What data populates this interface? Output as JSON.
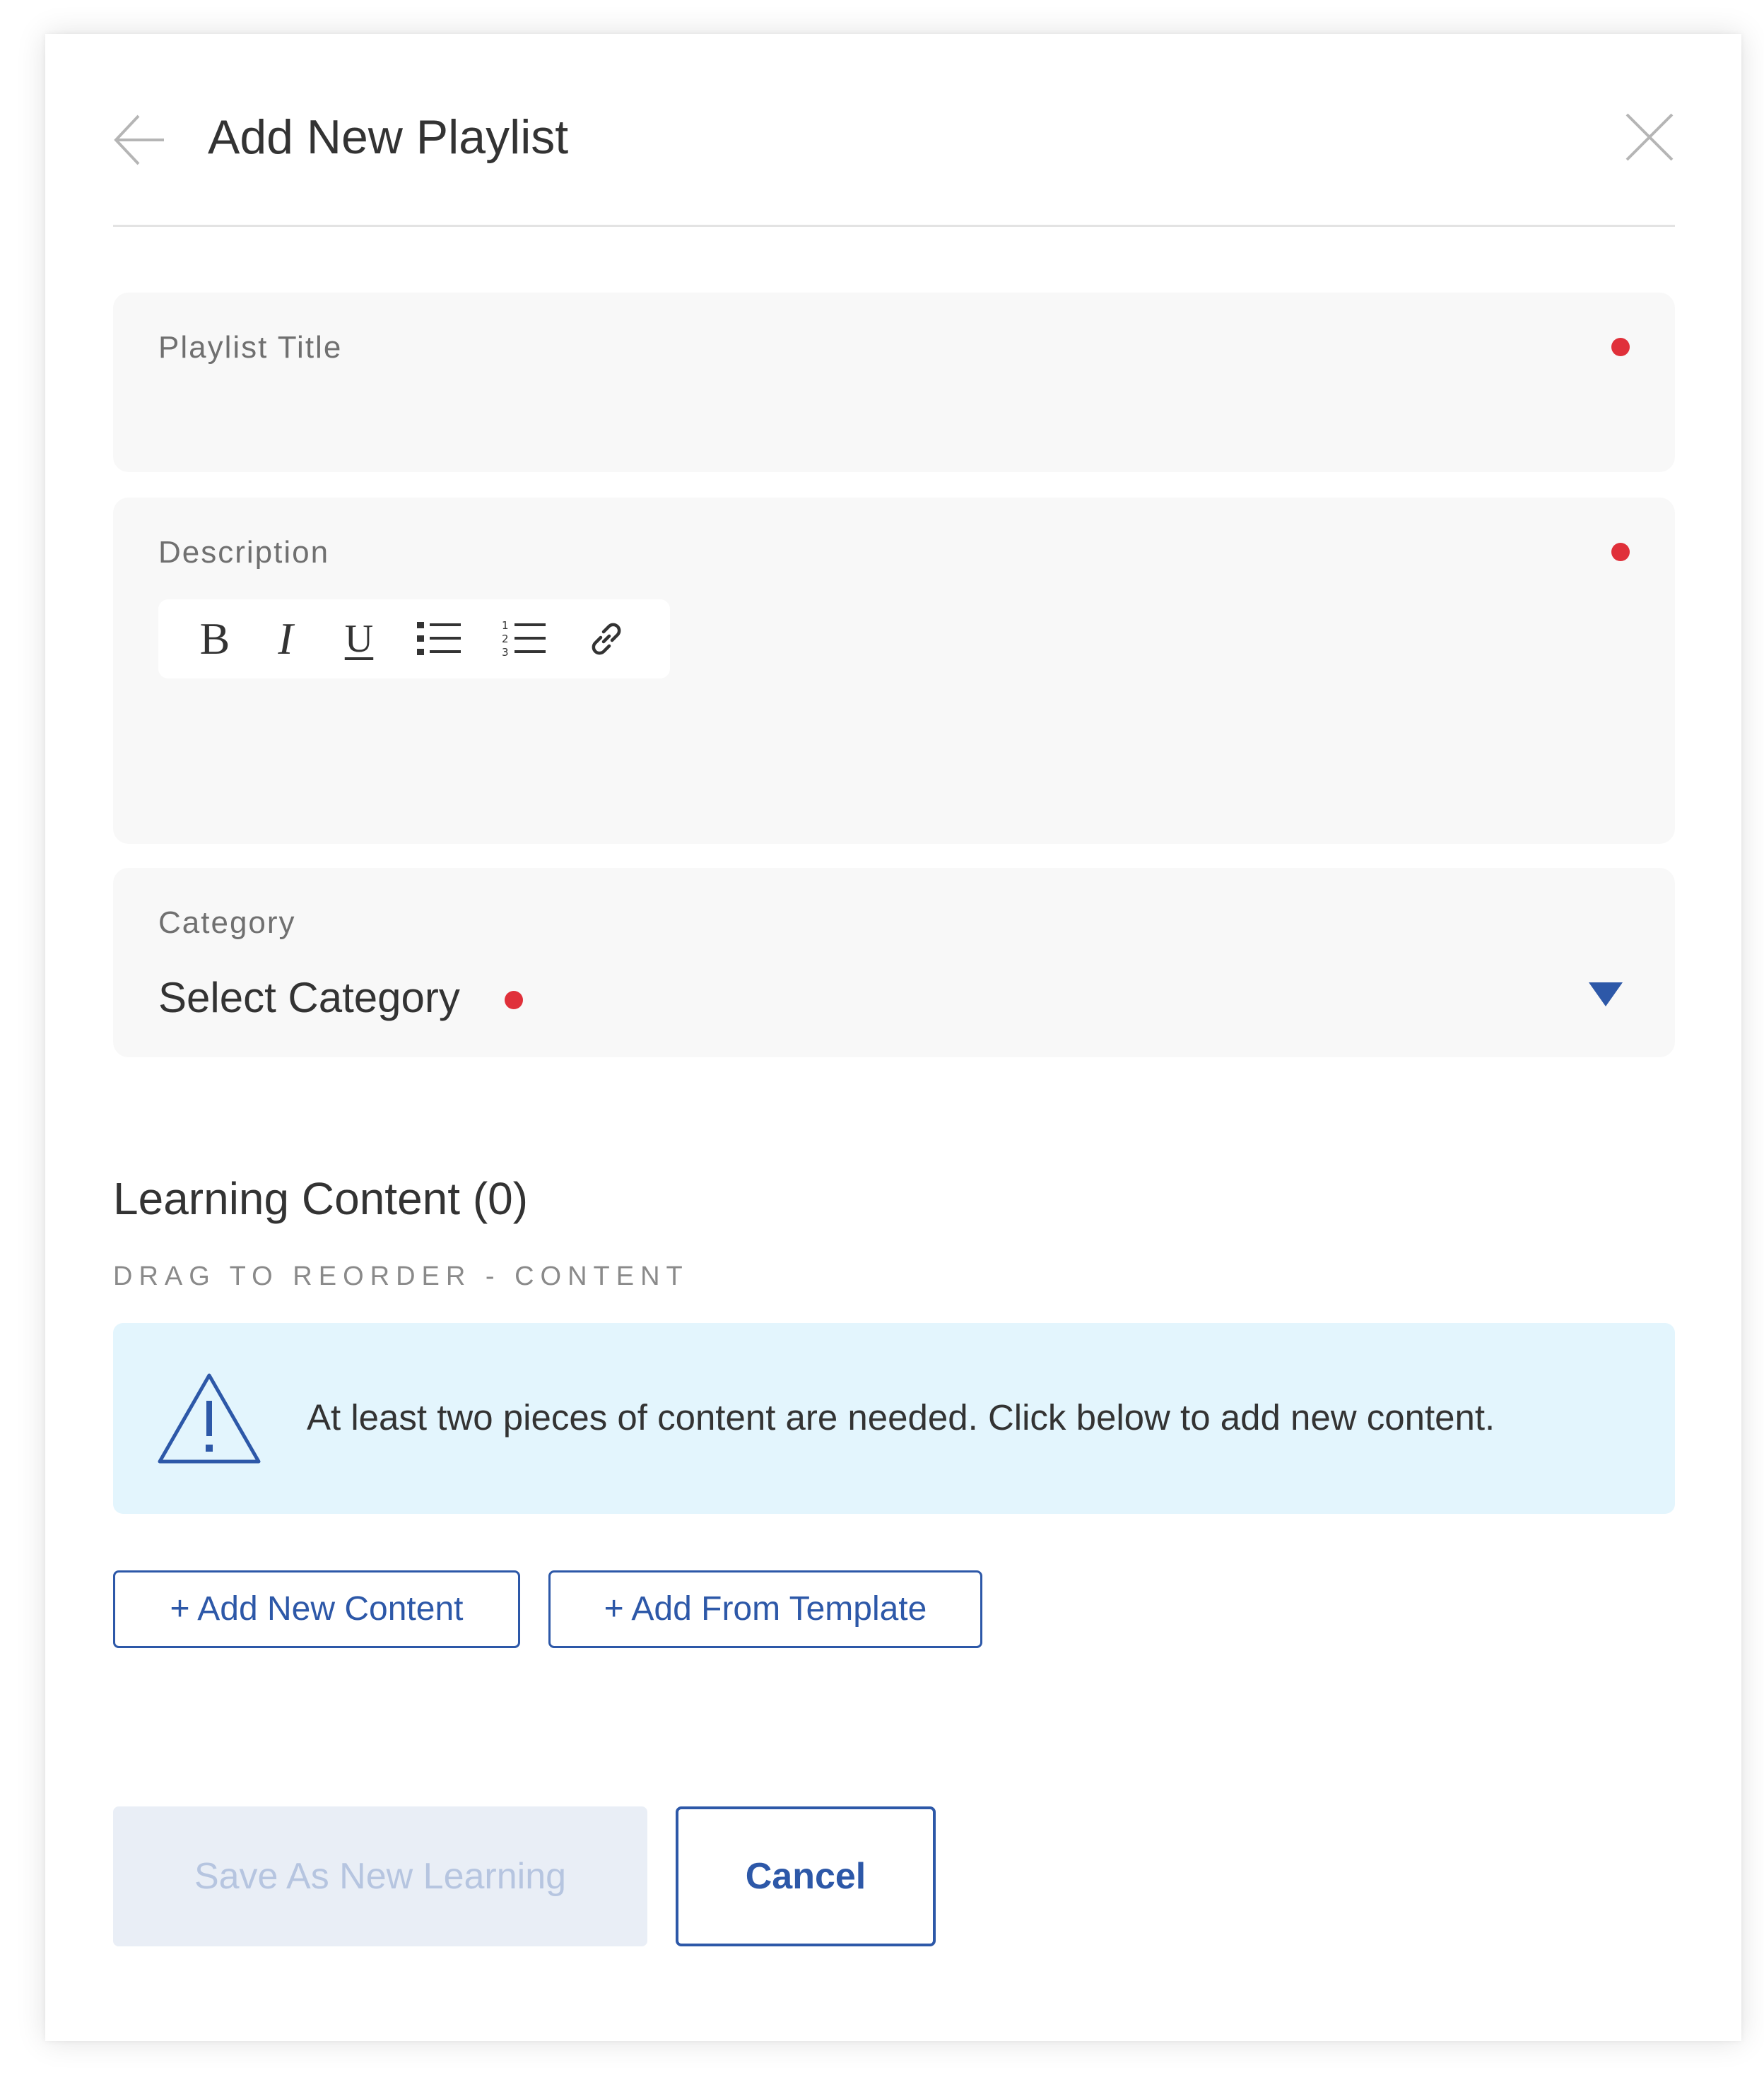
{
  "header": {
    "title": "Add New Playlist",
    "back_icon": "arrow-left-icon",
    "close_icon": "close-icon"
  },
  "form": {
    "title_field": {
      "label": "Playlist Title",
      "value": "",
      "required": true
    },
    "description_field": {
      "label": "Description",
      "required": true,
      "toolbar": {
        "bold_label": "B",
        "italic_label": "I",
        "underline_label": "U",
        "bullet_list_icon": "bulleted-list-icon",
        "numbered_list_icon": "numbered-list-icon",
        "link_icon": "link-icon"
      }
    },
    "category_field": {
      "label": "Category",
      "selected": "Select Category",
      "required": true,
      "caret_icon": "caret-down-icon"
    }
  },
  "learning_content": {
    "title": "Learning Content (0)",
    "subtitle": "DRAG TO REORDER - CONTENT",
    "alert": {
      "icon": "warning-icon",
      "message": "At least two pieces of content are needed. Click below to add new content."
    },
    "add_new_content_label": "+ Add New Content",
    "add_from_template_label": "+ Add From Template"
  },
  "actions": {
    "save_label": "Save As New Learning",
    "cancel_label": "Cancel"
  },
  "colors": {
    "accent": "#2d58a8",
    "required_dot": "#e0303a",
    "alert_bg": "#e3f5fd",
    "field_bg": "#f8f8f8",
    "save_disabled_bg": "#e9eef6",
    "save_disabled_text": "#b6c5e0"
  }
}
